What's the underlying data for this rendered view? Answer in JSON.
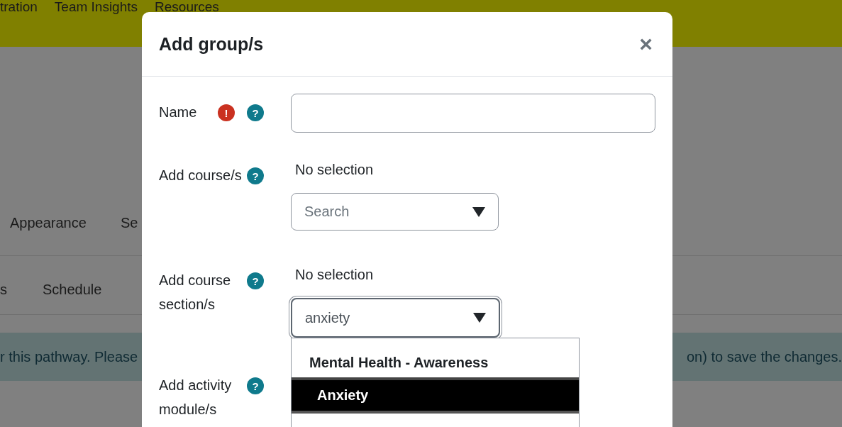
{
  "top_nav": [
    {
      "label": "tration"
    },
    {
      "label": "Team Insights"
    },
    {
      "label": "Resources"
    }
  ],
  "tabs": [
    {
      "label": "Appearance"
    },
    {
      "label": "Se"
    }
  ],
  "subtabs": [
    {
      "label": "s"
    },
    {
      "label": "Schedule"
    }
  ],
  "alert": {
    "text_left": "r this pathway. Please",
    "text_right": "on) to save the changes."
  },
  "dialog": {
    "title": "Add group/s",
    "close": "×",
    "fields": [
      {
        "kind": "text",
        "label": "Name",
        "required_mark": "!",
        "help_mark": "?"
      },
      {
        "kind": "autocomplete",
        "label": "Add course/s",
        "help_mark": "?",
        "selection": "No selection",
        "placeholder": "Search",
        "focused": false
      },
      {
        "kind": "autocomplete",
        "label": "Add course section/s",
        "help_mark": "?",
        "selection": "No selection",
        "value": "anxiety",
        "focused": true,
        "options": [
          {
            "kind": "group",
            "label": "Mental Health - Awareness"
          },
          {
            "kind": "option",
            "label": "Anxiety",
            "selected": true
          }
        ]
      },
      {
        "kind": "autocomplete",
        "label": "Add activity module/s",
        "help_mark": "?"
      }
    ]
  }
}
